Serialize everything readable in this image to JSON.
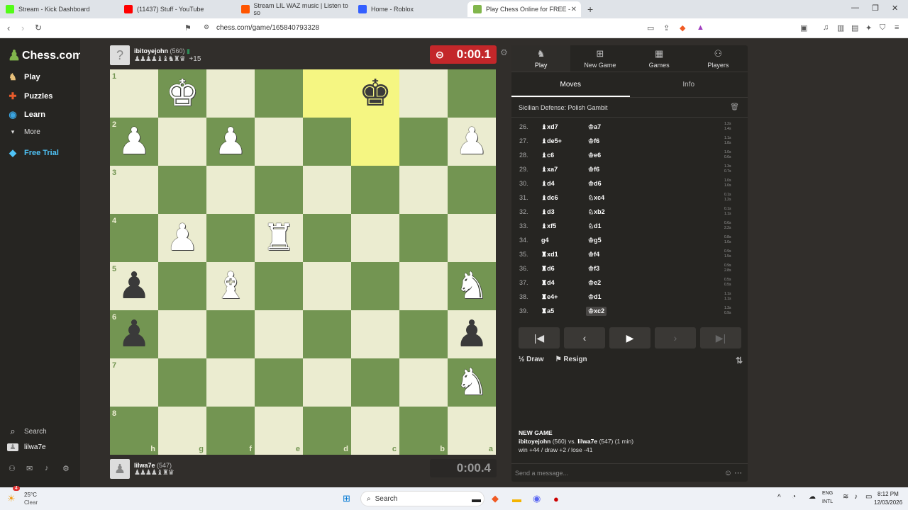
{
  "browser": {
    "tabs": [
      {
        "title": "Stream - Kick Dashboard",
        "color": "#53fc18"
      },
      {
        "title": "(11437) Stuff - YouTube",
        "color": "#ff0000"
      },
      {
        "title": "Stream LIL WAZ music | Listen to so",
        "color": "#ff5500"
      },
      {
        "title": "Home - Roblox",
        "color": "#335fff"
      },
      {
        "title": "Play Chess Online for FREE - ",
        "color": "#81b64c"
      }
    ],
    "url": "chess.com/game/165840793328"
  },
  "sidebar": {
    "logo": "Chess.com",
    "items": [
      {
        "label": "Play",
        "icon": "play-icon",
        "color": "#e8c07a"
      },
      {
        "label": "Puzzles",
        "icon": "puzzle-icon",
        "color": "#e85c2c"
      },
      {
        "label": "Learn",
        "icon": "learn-icon",
        "color": "#3aa4e0"
      },
      {
        "label": "More",
        "icon": "chevron-down-icon",
        "color": "#ccc"
      },
      {
        "label": "Free Trial",
        "icon": "diamond-icon",
        "color": "#4fc3f7"
      }
    ],
    "search_label": "Search",
    "user": "lilwa7e"
  },
  "top_player": {
    "name": "ibitoyejohn",
    "rating": "(560)",
    "material": "+15",
    "captured": "♟♟♟♟♝♝♞♜♛",
    "clock": "0:00.1"
  },
  "bottom_player": {
    "name": "lilwa7e",
    "rating": "(547)",
    "captured": "♟♟♟♟♝♜♛",
    "clock": "0:00.4"
  },
  "board": {
    "ranks": [
      "1",
      "2",
      "3",
      "4",
      "5",
      "6",
      "7",
      "8"
    ],
    "files": [
      "h",
      "g",
      "f",
      "e",
      "d",
      "c",
      "b",
      "a"
    ],
    "pieces": [
      [
        "",
        "♚w",
        "",
        "",
        "",
        "♚b",
        "",
        ""
      ],
      [
        "♟w",
        "",
        "♟w",
        "",
        "",
        "",
        "",
        "♟w"
      ],
      [
        "",
        "",
        "",
        "",
        "",
        "",
        "",
        ""
      ],
      [
        "",
        "♟w",
        "",
        "♜w",
        "",
        "",
        "",
        ""
      ],
      [
        "♟b",
        "",
        "♝w",
        "",
        "",
        "",
        "",
        "♞w"
      ],
      [
        "♟b",
        "",
        "",
        "",
        "",
        "",
        "",
        "♟b"
      ],
      [
        "",
        "",
        "",
        "",
        "",
        "",
        "",
        "♞w"
      ],
      [
        "",
        "",
        "",
        "",
        "",
        "",
        "",
        ""
      ]
    ],
    "highlights": [
      [
        0,
        4
      ],
      [
        0,
        5
      ],
      [
        1,
        5
      ]
    ]
  },
  "panel": {
    "tabs": [
      "Play",
      "New Game",
      "Games",
      "Players"
    ],
    "subtabs": [
      "Moves",
      "Info"
    ],
    "opening": "Sicilian Defense: Polish Gambit",
    "moves": [
      {
        "n": "26.",
        "w": "♝xd7",
        "b": "♔a7",
        "t1": "1.2s",
        "t2": "1.4s"
      },
      {
        "n": "27.",
        "w": "♝de5+",
        "b": "♔f6",
        "t1": "1.1s",
        "t2": "1.8s"
      },
      {
        "n": "28.",
        "w": "♝c6",
        "b": "♔e6",
        "t1": "1.0s",
        "t2": "0.6s"
      },
      {
        "n": "29.",
        "w": "♝xa7",
        "b": "♔f6",
        "t1": "1.3s",
        "t2": "0.7s"
      },
      {
        "n": "30.",
        "w": "♝d4",
        "b": "♔d6",
        "t1": "1.0s",
        "t2": "1.0s"
      },
      {
        "n": "31.",
        "w": "♝dc6",
        "b": "♘xc4",
        "t1": "0.1s",
        "t2": "1.2s"
      },
      {
        "n": "32.",
        "w": "♝d3",
        "b": "♘xb2",
        "t1": "0.1s",
        "t2": "1.1s"
      },
      {
        "n": "33.",
        "w": "♝xf5",
        "b": "♘d1",
        "t1": "0.6s",
        "t2": "2.2s"
      },
      {
        "n": "34.",
        "w": "g4",
        "b": "♔g5",
        "t1": "0.8s",
        "t2": "1.0s"
      },
      {
        "n": "35.",
        "w": "♜xd1",
        "b": "♔f4",
        "t1": "0.9s",
        "t2": "1.5s"
      },
      {
        "n": "36.",
        "w": "♜d6",
        "b": "♔f3",
        "t1": "0.9s",
        "t2": "2.8s"
      },
      {
        "n": "37.",
        "w": "♜d4",
        "b": "♔e2",
        "t1": "0.5s",
        "t2": "0.5s"
      },
      {
        "n": "38.",
        "w": "♜e4+",
        "b": "♔d1",
        "t1": "1.1s",
        "t2": "1.1s"
      },
      {
        "n": "39.",
        "w": "♜a5",
        "b": "♔xc2",
        "t1": "1.3s",
        "t2": "0.9s"
      }
    ],
    "draw": "Draw",
    "resign": "Resign",
    "new_game_title": "NEW GAME",
    "new_game_players_a": "ibitoyejohn",
    "new_game_rating_a": "(560)",
    "new_game_vs": "vs.",
    "new_game_players_b": "lilwa7e",
    "new_game_rating_b": "(547) (1 min)",
    "new_game_stats": "win +44 / draw +2 / lose -41",
    "message_placeholder": "Send a message..."
  },
  "taskbar": {
    "weather_temp": "25°C",
    "weather_desc": "Clear",
    "search": "Search",
    "lang1": "ENG",
    "lang2": "INTL",
    "time": "8:12 PM",
    "date": "12/03/2026",
    "notif_count": "4"
  }
}
